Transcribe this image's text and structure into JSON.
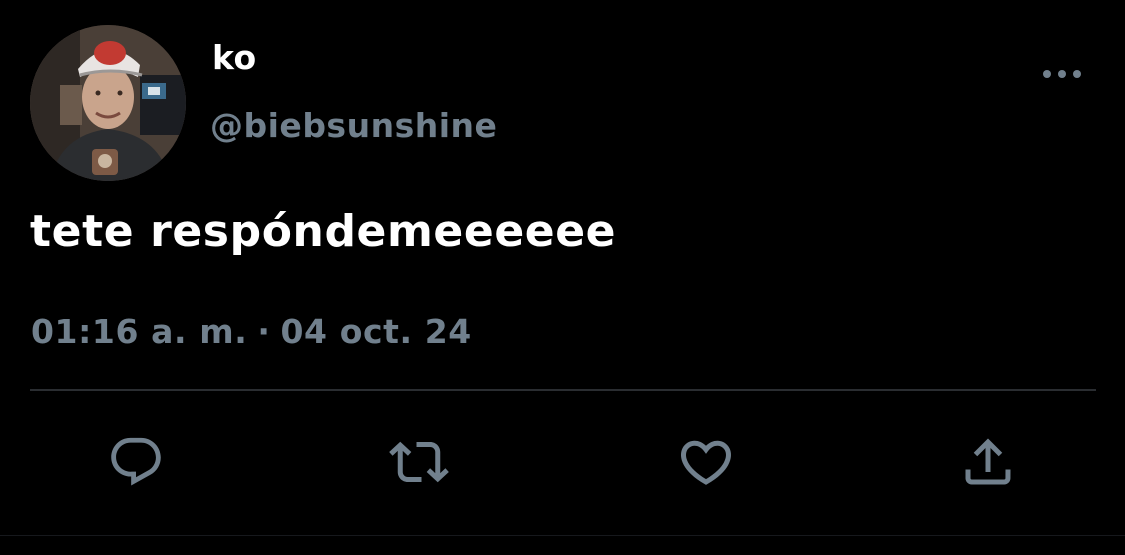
{
  "tweet": {
    "display_name": "ko",
    "handle": "@biebsunshine",
    "text": "tete respóndemeeeeee",
    "time": "01:16 a. m.",
    "separator": "·",
    "date": "04 oct. 24"
  },
  "icons": {
    "more": "more-horizontal-icon",
    "reply": "reply-icon",
    "retweet": "retweet-icon",
    "like": "heart-icon",
    "share": "share-icon"
  },
  "colors": {
    "background": "#000000",
    "primary_text": "#ffffff",
    "secondary_text": "#71808d",
    "divider": "#2a2d31"
  }
}
